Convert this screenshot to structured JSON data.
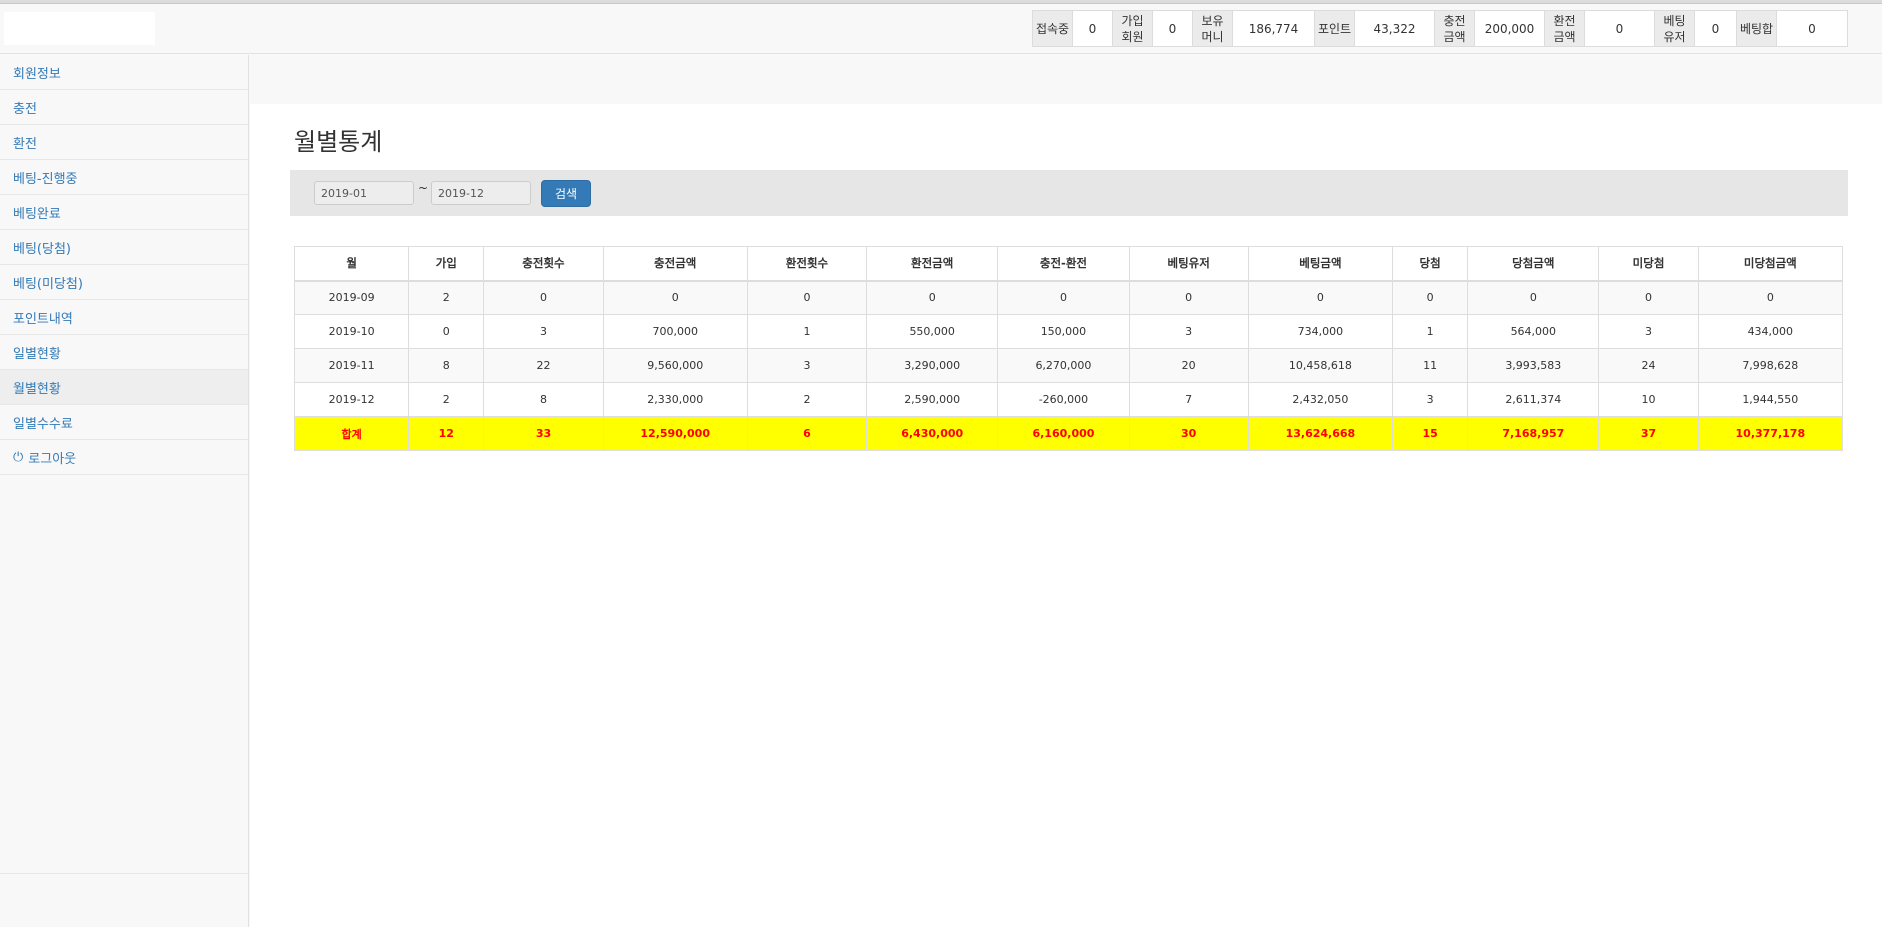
{
  "header": {
    "stats": [
      {
        "label": "접속중",
        "value": "0"
      },
      {
        "label": "가입\n회원",
        "value": "0"
      },
      {
        "label": "보유\n머니",
        "value": "186,774"
      },
      {
        "label": "포인트",
        "value": "43,322"
      },
      {
        "label": "충전\n금액",
        "value": "200,000"
      },
      {
        "label": "환전\n금액",
        "value": "0"
      },
      {
        "label": "베팅\n유저",
        "value": "0"
      },
      {
        "label": "베팅합",
        "value": "0"
      }
    ]
  },
  "sidebar": {
    "items": [
      {
        "label": "회원정보"
      },
      {
        "label": "충전"
      },
      {
        "label": "환전"
      },
      {
        "label": "베팅-진행중"
      },
      {
        "label": "베팅완료"
      },
      {
        "label": "베팅(당첨)"
      },
      {
        "label": "베팅(미당첨)"
      },
      {
        "label": "포인트내역"
      },
      {
        "label": "일별현황"
      },
      {
        "label": "월별현황",
        "active": true
      },
      {
        "label": "일별수수료"
      }
    ],
    "logout_label": "로그아웃"
  },
  "main": {
    "title": "월별통계",
    "filter": {
      "from": "2019-01",
      "to": "2019-12",
      "separator": "~",
      "search_label": "검색"
    },
    "table": {
      "headers": [
        "월",
        "가입",
        "충전횟수",
        "충전금액",
        "환전횟수",
        "환전금액",
        "충전-환전",
        "베팅유저",
        "베팅금액",
        "당첨",
        "당첨금액",
        "미당첨",
        "미당첨금액"
      ],
      "rows": [
        [
          "2019-09",
          "2",
          "0",
          "0",
          "0",
          "0",
          "0",
          "0",
          "0",
          "0",
          "0",
          "0",
          "0"
        ],
        [
          "2019-10",
          "0",
          "3",
          "700,000",
          "1",
          "550,000",
          "150,000",
          "3",
          "734,000",
          "1",
          "564,000",
          "3",
          "434,000"
        ],
        [
          "2019-11",
          "8",
          "22",
          "9,560,000",
          "3",
          "3,290,000",
          "6,270,000",
          "20",
          "10,458,618",
          "11",
          "3,993,583",
          "24",
          "7,998,628"
        ],
        [
          "2019-12",
          "2",
          "8",
          "2,330,000",
          "2",
          "2,590,000",
          "-260,000",
          "7",
          "2,432,050",
          "3",
          "2,611,374",
          "10",
          "1,944,550"
        ]
      ],
      "total": [
        "합계",
        "12",
        "33",
        "12,590,000",
        "6",
        "6,430,000",
        "6,160,000",
        "30",
        "13,624,668",
        "15",
        "7,168,957",
        "37",
        "10,377,178"
      ]
    }
  },
  "colors": {
    "link": "#337ab7",
    "total_bg": "#ffff00",
    "total_text": "#ff0000",
    "button": "#337ab7"
  },
  "icons": {
    "logout": "power-icon"
  }
}
